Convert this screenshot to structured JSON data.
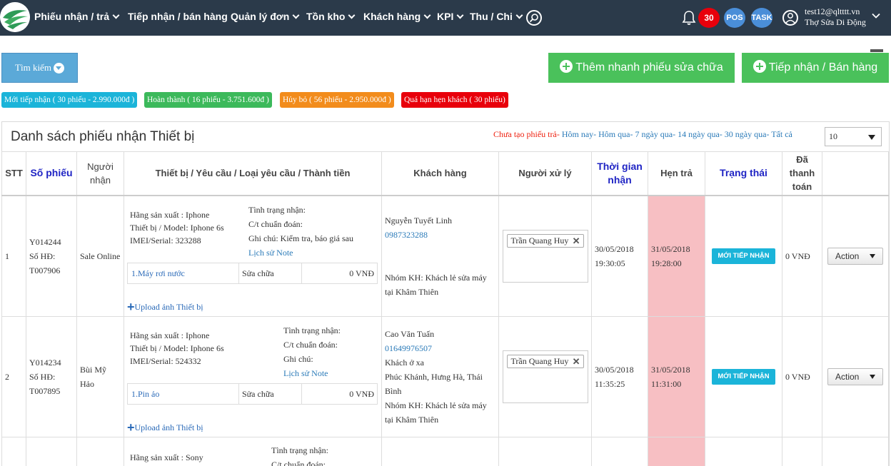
{
  "nav": {
    "items": [
      {
        "label": "Phiếu nhận / trả",
        "has_dropdown": true
      },
      {
        "label": "Tiếp nhận / bán hàng",
        "has_dropdown": false
      },
      {
        "label": "Quản lý đơn",
        "has_dropdown": true
      },
      {
        "label": "Tồn kho",
        "has_dropdown": true
      },
      {
        "label": "Khách hàng",
        "has_dropdown": true
      },
      {
        "label": "KPI",
        "has_dropdown": true
      },
      {
        "label": "Thu / Chi",
        "has_dropdown": true
      }
    ],
    "notification_count": "30",
    "pos_label": "POS",
    "task_label": "TASK",
    "user_email": "test12@qltttt.vn",
    "user_name": "Thợ Sửa Di Động"
  },
  "toolbar": {
    "search_label": "Tìm kiếm",
    "quick_add_label": "Thêm nhanh phiếu sửa chữa",
    "receive_label": "Tiếp nhận / Bán hàng"
  },
  "status_badges": [
    {
      "label": "Mới tiếp nhận ( 30 phiếu - 2.990.000đ )",
      "color": "#1bb4d9"
    },
    {
      "label": "Hoàn thành ( 16 phiếu - 3.751.600đ )",
      "color": "#3cb95b"
    },
    {
      "label": "Hủy bỏ ( 56 phiếu - 2.950.000đ )",
      "color": "#f28c1c"
    },
    {
      "label": "Quá hạn hẹn khách ( 30 phiếu)",
      "color": "#e8000b"
    }
  ],
  "panel": {
    "title": "Danh sách phiếu nhận Thiết bị",
    "filter_red": "Chưa tạo phiếu trả",
    "filters": [
      "Hôm nay",
      "Hôm qua",
      "7 ngày qua",
      "14 ngày qua",
      "30 ngày qua",
      "Tất cả"
    ],
    "page_size": "10"
  },
  "table": {
    "headers": {
      "stt": "STT",
      "so_phieu": "Số phiếu",
      "nguoi_nhan": "Người nhận",
      "thiet_bi": "Thiết bị / Yêu cầu / Loại yêu cầu / Thành tiền",
      "khach_hang": "Khách hàng",
      "nguoi_xu_ly": "Người xử lý",
      "thoi_gian": "Thời gian nhận",
      "hen_tra": "Hẹn trả",
      "trang_thai": "Trạng thái",
      "da_thanh_toan": "Đã thanh toán"
    },
    "rows": [
      {
        "stt": "1",
        "so_phieu": "Y014244",
        "so_hd": "Số HĐ: T007906",
        "nguoi_nhan": "Sale Online",
        "hang_sx": "Hãng sản xuất : Iphone",
        "model": "Thiết bị / Model: Iphone 6s",
        "imei": "IMEI/Serial: 323288",
        "tinh_trang": "Tình trạng nhận:",
        "chuan_doan": "C/t chuẩn đoán:",
        "ghi_chu": "Ghi chú: Kiểm tra, báo giá sau",
        "lich_su": "Lịch sử Note",
        "yeu_cau": "1.Máy rơi nước",
        "loai": "Sửa chữa",
        "thanh_tien": "0 VNĐ",
        "upload": "Upload ảnh Thiết bị",
        "kh_name": "Nguyễn Tuyết Linh",
        "kh_phone": "0987323288",
        "kh_extra": "",
        "kh_group": "Nhóm KH: Khách lẻ sửa máy tại Khâm Thiên",
        "xu_ly": "Trần Quang Huy",
        "thoi_gian": "30/05/2018 19:30:05",
        "hen_tra": "31/05/2018 19:28:00",
        "trang_thai": "MỚI TIẾP NHẬN",
        "thanh_toan": "0 VNĐ",
        "action": "Action"
      },
      {
        "stt": "2",
        "so_phieu": "Y014234",
        "so_hd": "Số HĐ: T007895",
        "nguoi_nhan": "Bùi Mỹ Hảo",
        "hang_sx": "Hãng sản xuất : Iphone",
        "model": "Thiết bị / Model: Iphone 6s",
        "imei": "IMEI/Serial: 524332",
        "tinh_trang": "Tình trạng nhận:",
        "chuan_doan": "C/t chuẩn đoán:",
        "ghi_chu": "Ghi chú:",
        "lich_su": "Lịch sử Note",
        "yeu_cau": "1.Pin ảo",
        "loai": "Sửa chữa",
        "thanh_tien": "0 VNĐ",
        "upload": "Upload ảnh Thiết bị",
        "kh_name": "Cao Văn Tuấn",
        "kh_phone": "01649976507",
        "kh_extra": "Khách ở xa",
        "kh_address": "Phúc Khánh, Hưng Hà, Thái Bình",
        "kh_group": "Nhóm KH: Khách lẻ sửa máy tại Khâm Thiên",
        "xu_ly": "Trần Quang Huy",
        "thoi_gian": "30/05/2018 11:35:25",
        "hen_tra": "31/05/2018 11:31:00",
        "trang_thai": "MỚI TIẾP NHẬN",
        "thanh_toan": "0 VNĐ",
        "action": "Action"
      },
      {
        "hang_sx": "Hãng sản xuất : Sony",
        "tinh_trang": "Tình trạng nhận:",
        "chuan_doan": "C/t chuẩn đoán:"
      }
    ]
  }
}
